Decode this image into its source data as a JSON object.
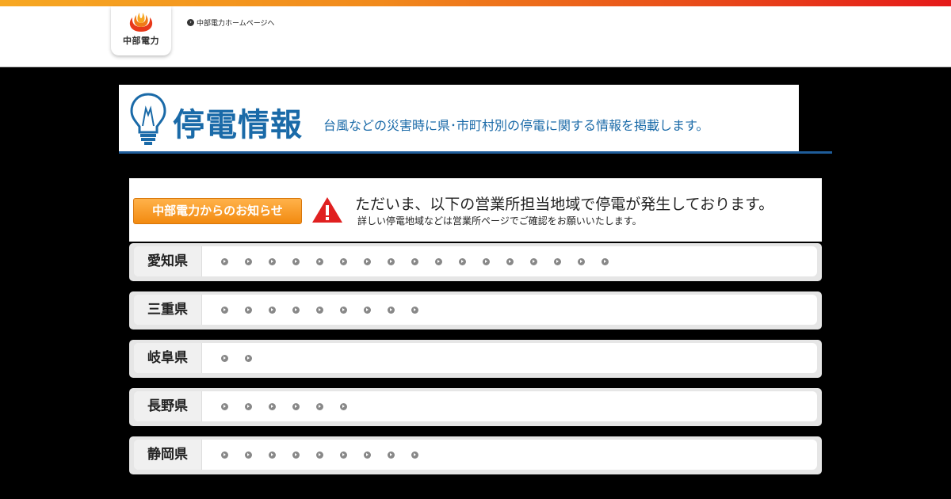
{
  "header": {
    "logo_text": "中部電力",
    "home_link": "中部電力ホームページへ"
  },
  "banner": {
    "title": "停電情報",
    "subtitle": "台風などの災害時に県･市町村別の停電に関する情報を掲載します。"
  },
  "notice": {
    "button_label": "中部電力からのお知らせ",
    "main_text": "ただいま、以下の営業所担当地域で停電が発生しております。",
    "sub_text": "詳しい停電地域などは営業所ページでご確認をお願いいたします。"
  },
  "prefectures": [
    {
      "name": "愛知県",
      "office_count": 17
    },
    {
      "name": "三重県",
      "office_count": 9
    },
    {
      "name": "岐阜県",
      "office_count": 2
    },
    {
      "name": "長野県",
      "office_count": 6
    },
    {
      "name": "静岡県",
      "office_count": 9
    }
  ],
  "colors": {
    "brand_blue": "#1a6aa8",
    "accent_orange": "#f28a10",
    "warning_red": "#e02020"
  }
}
